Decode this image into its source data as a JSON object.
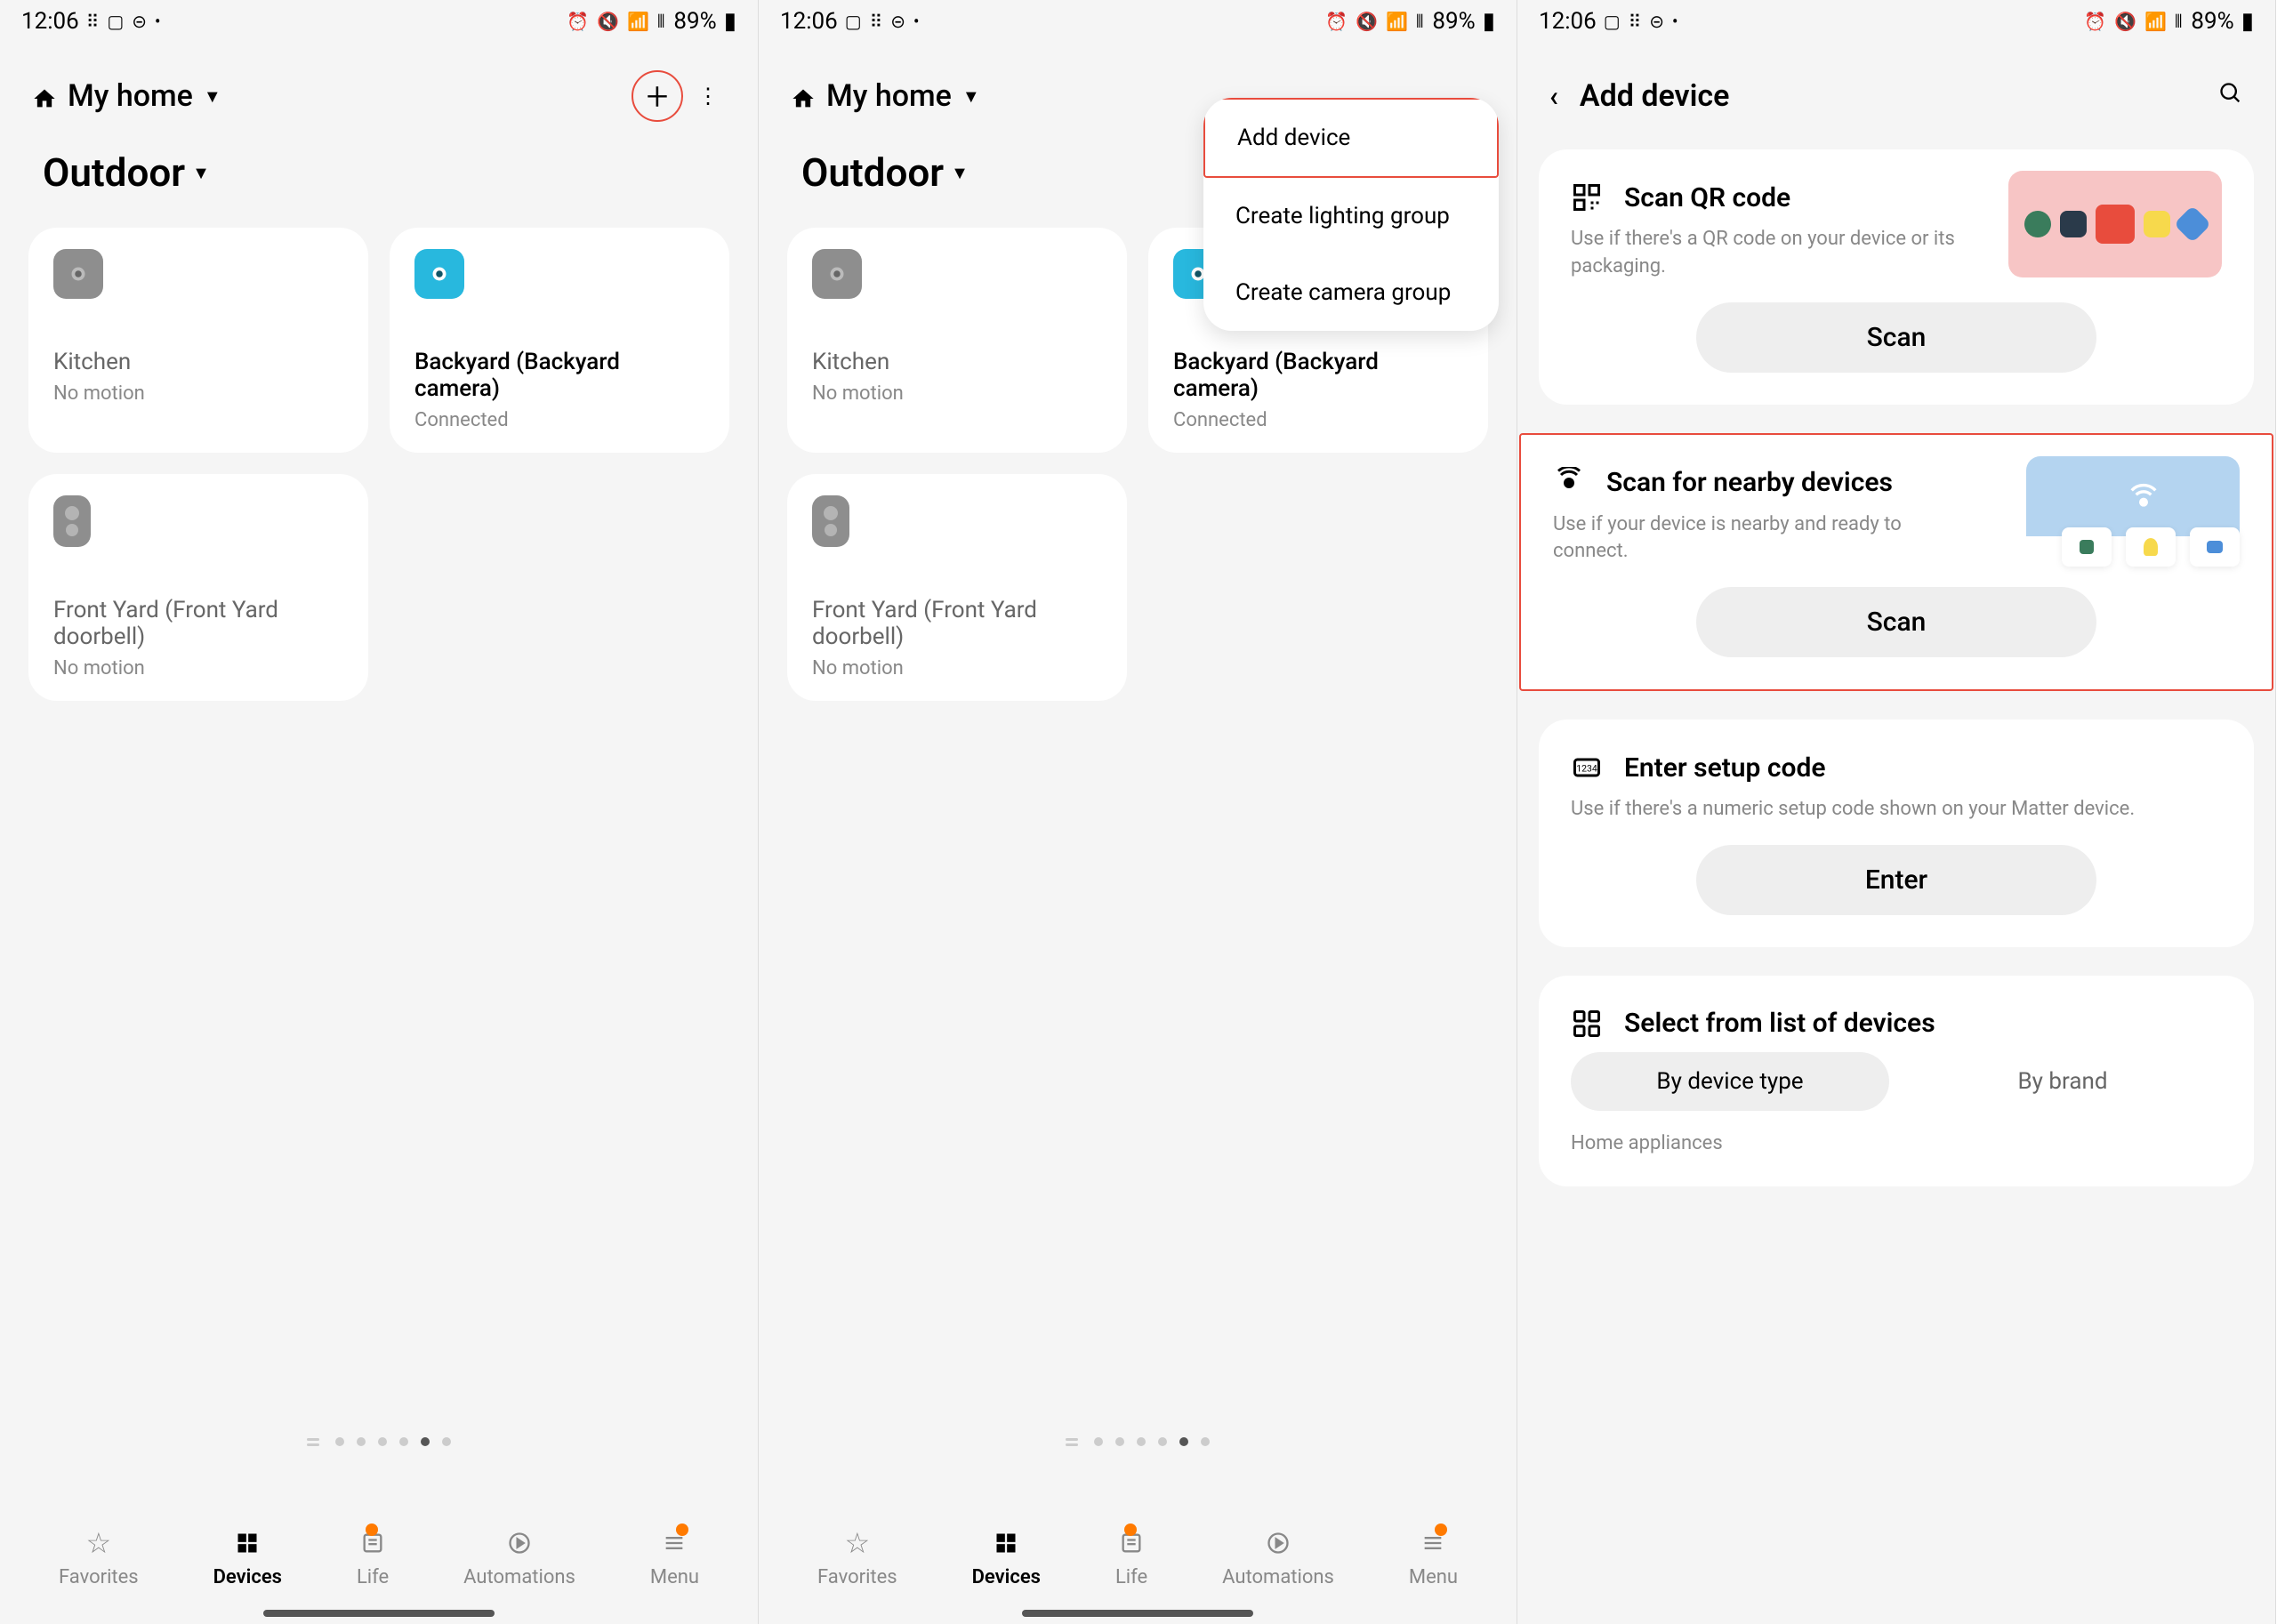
{
  "status": {
    "time": "12:06",
    "battery": "89%"
  },
  "home": {
    "title": "My home",
    "room": "Outdoor"
  },
  "devices": {
    "kitchen": {
      "name": "Kitchen",
      "status": "No motion"
    },
    "backyard": {
      "name": "Backyard (Backyard camera)",
      "status": "Connected"
    },
    "frontyard": {
      "name": "Front Yard (Front Yard doorbell)",
      "status": "No motion"
    }
  },
  "nav": {
    "favorites": "Favorites",
    "devices": "Devices",
    "life": "Life",
    "automations": "Automations",
    "menu": "Menu"
  },
  "popup": {
    "add_device": "Add device",
    "lighting": "Create lighting group",
    "camera": "Create camera group"
  },
  "add": {
    "title": "Add device",
    "qr": {
      "title": "Scan QR code",
      "desc": "Use if there's a QR code on your device or its packaging.",
      "btn": "Scan"
    },
    "nearby": {
      "title": "Scan for nearby devices",
      "desc": "Use if your device is nearby and ready to connect.",
      "btn": "Scan"
    },
    "setup": {
      "title": "Enter setup code",
      "desc": "Use if there's a numeric setup code shown on your Matter device.",
      "btn": "Enter"
    },
    "select": {
      "title": "Select from list of devices",
      "by_type": "By device type",
      "by_brand": "By brand",
      "section": "Home appliances"
    }
  }
}
